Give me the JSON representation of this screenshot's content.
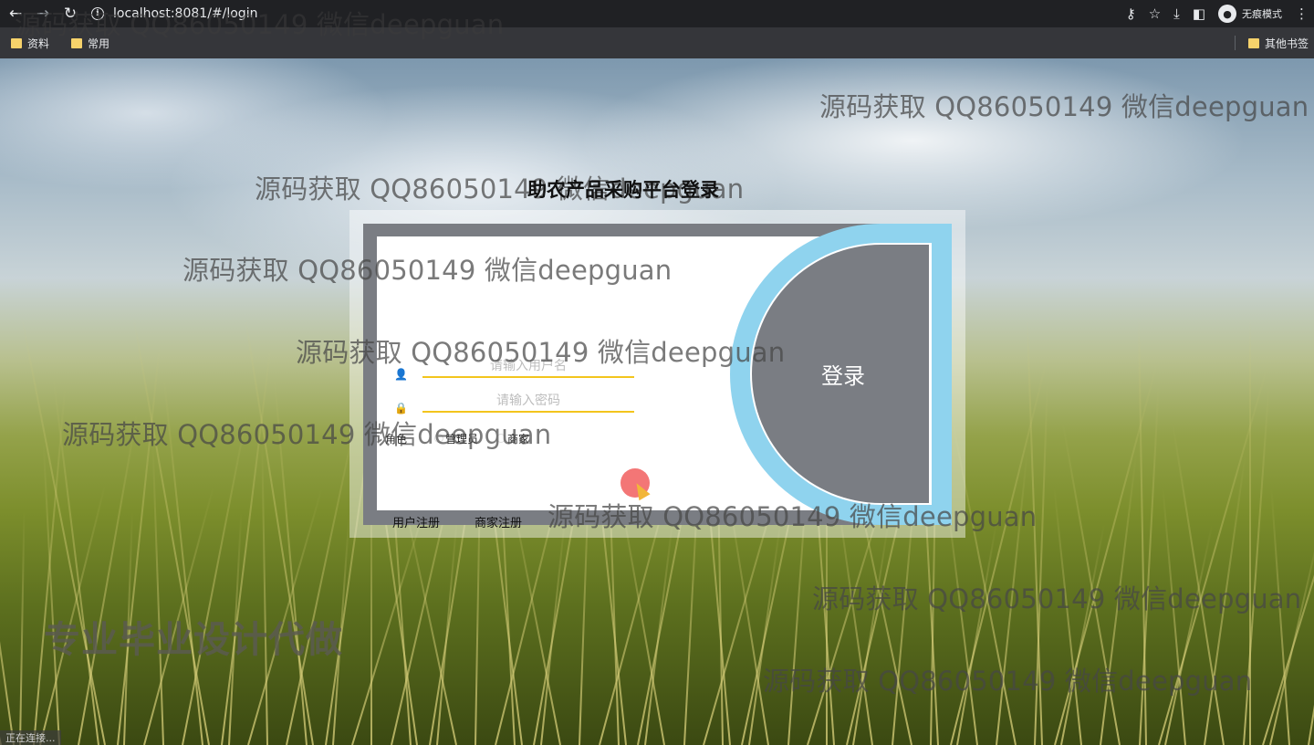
{
  "browser": {
    "url": "localhost:8081/#/login",
    "incognito_label": "无痕模式",
    "bookmarks": [
      "资料",
      "常用"
    ],
    "other_bookmarks": "其他书签",
    "status_text": "正在连接..."
  },
  "watermark": "源码获取 QQ86050149 微信deepguan",
  "ad_text": "专业毕业设计代做",
  "login": {
    "title": "助农产品采购平台登录",
    "username_placeholder": "请输入用户名",
    "password_placeholder": "请输入密码",
    "role_label": "角色",
    "roles": [
      "管理员",
      "商家"
    ],
    "submit_label": "登录",
    "user_register": "用户注册",
    "merchant_register": "商家注册"
  },
  "icons": [
    "back-icon",
    "forward-icon",
    "reload-icon",
    "info-icon",
    "key-icon",
    "star-icon",
    "download-icon",
    "sidebar-icon",
    "incognito-icon",
    "menu-icon",
    "folder-icon",
    "user-icon",
    "lock-icon"
  ]
}
